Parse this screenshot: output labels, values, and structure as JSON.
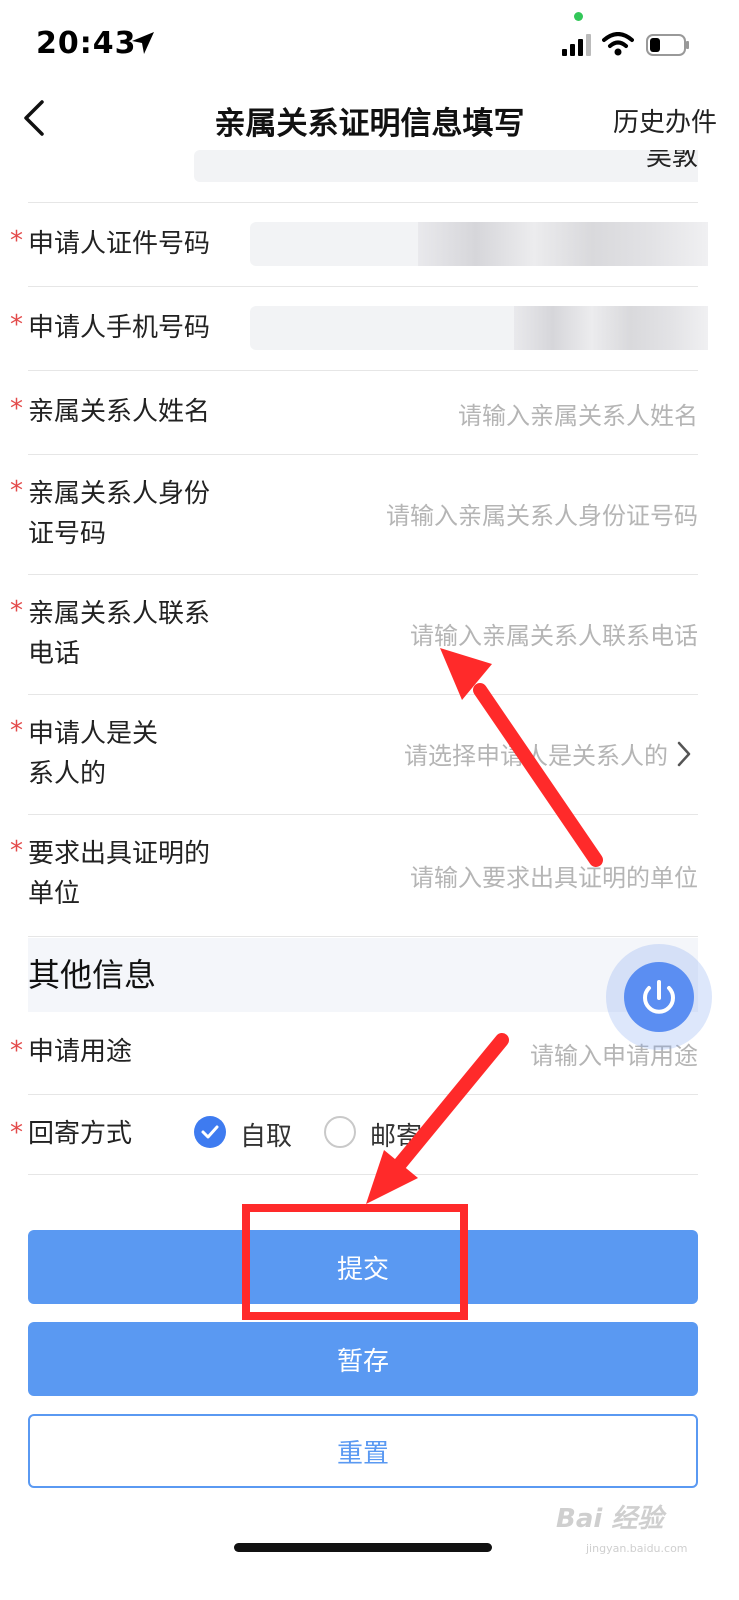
{
  "status_bar": {
    "time": "20:43"
  },
  "nav": {
    "title": "亲属关系证明信息填写",
    "history": "历史办件"
  },
  "form": {
    "partial_top_value": "吴敦",
    "rows": [
      {
        "label": "申请人证件号码",
        "required": true
      },
      {
        "label": "申请人手机号码",
        "required": true
      },
      {
        "label": "亲属关系人姓名",
        "placeholder": "请输入亲属关系人姓名",
        "required": true
      },
      {
        "label_line1": "亲属关系人身份",
        "label_line2": "证号码",
        "placeholder": "请输入亲属关系人身份证号码",
        "required": true
      },
      {
        "label_line1": "亲属关系人联系",
        "label_line2": "电话",
        "placeholder": "请输入亲属关系人联系电话",
        "required": true
      },
      {
        "label_line1": "申请人是关",
        "label_line2": "系人的",
        "placeholder": "请选择申请人是关系人的",
        "required": true
      },
      {
        "label_line1": "要求出具证明的",
        "label_line2": "单位",
        "placeholder": "请输入要求出具证明的单位",
        "required": true
      }
    ]
  },
  "other_info": {
    "section_title": "其他信息",
    "purpose_label": "申请用途",
    "purpose_placeholder": "请输入申请用途",
    "delivery_label": "回寄方式",
    "option_self": "自取",
    "option_mail": "邮寄"
  },
  "buttons": {
    "submit": "提交",
    "save": "暂存",
    "reset": "重置"
  },
  "watermark": {
    "text": "Bai 经验",
    "sub": "jingyan.baidu.com"
  },
  "colors": {
    "accent": "#5a99f2",
    "required": "#e34b4b",
    "annotation": "#ff2a2a"
  }
}
